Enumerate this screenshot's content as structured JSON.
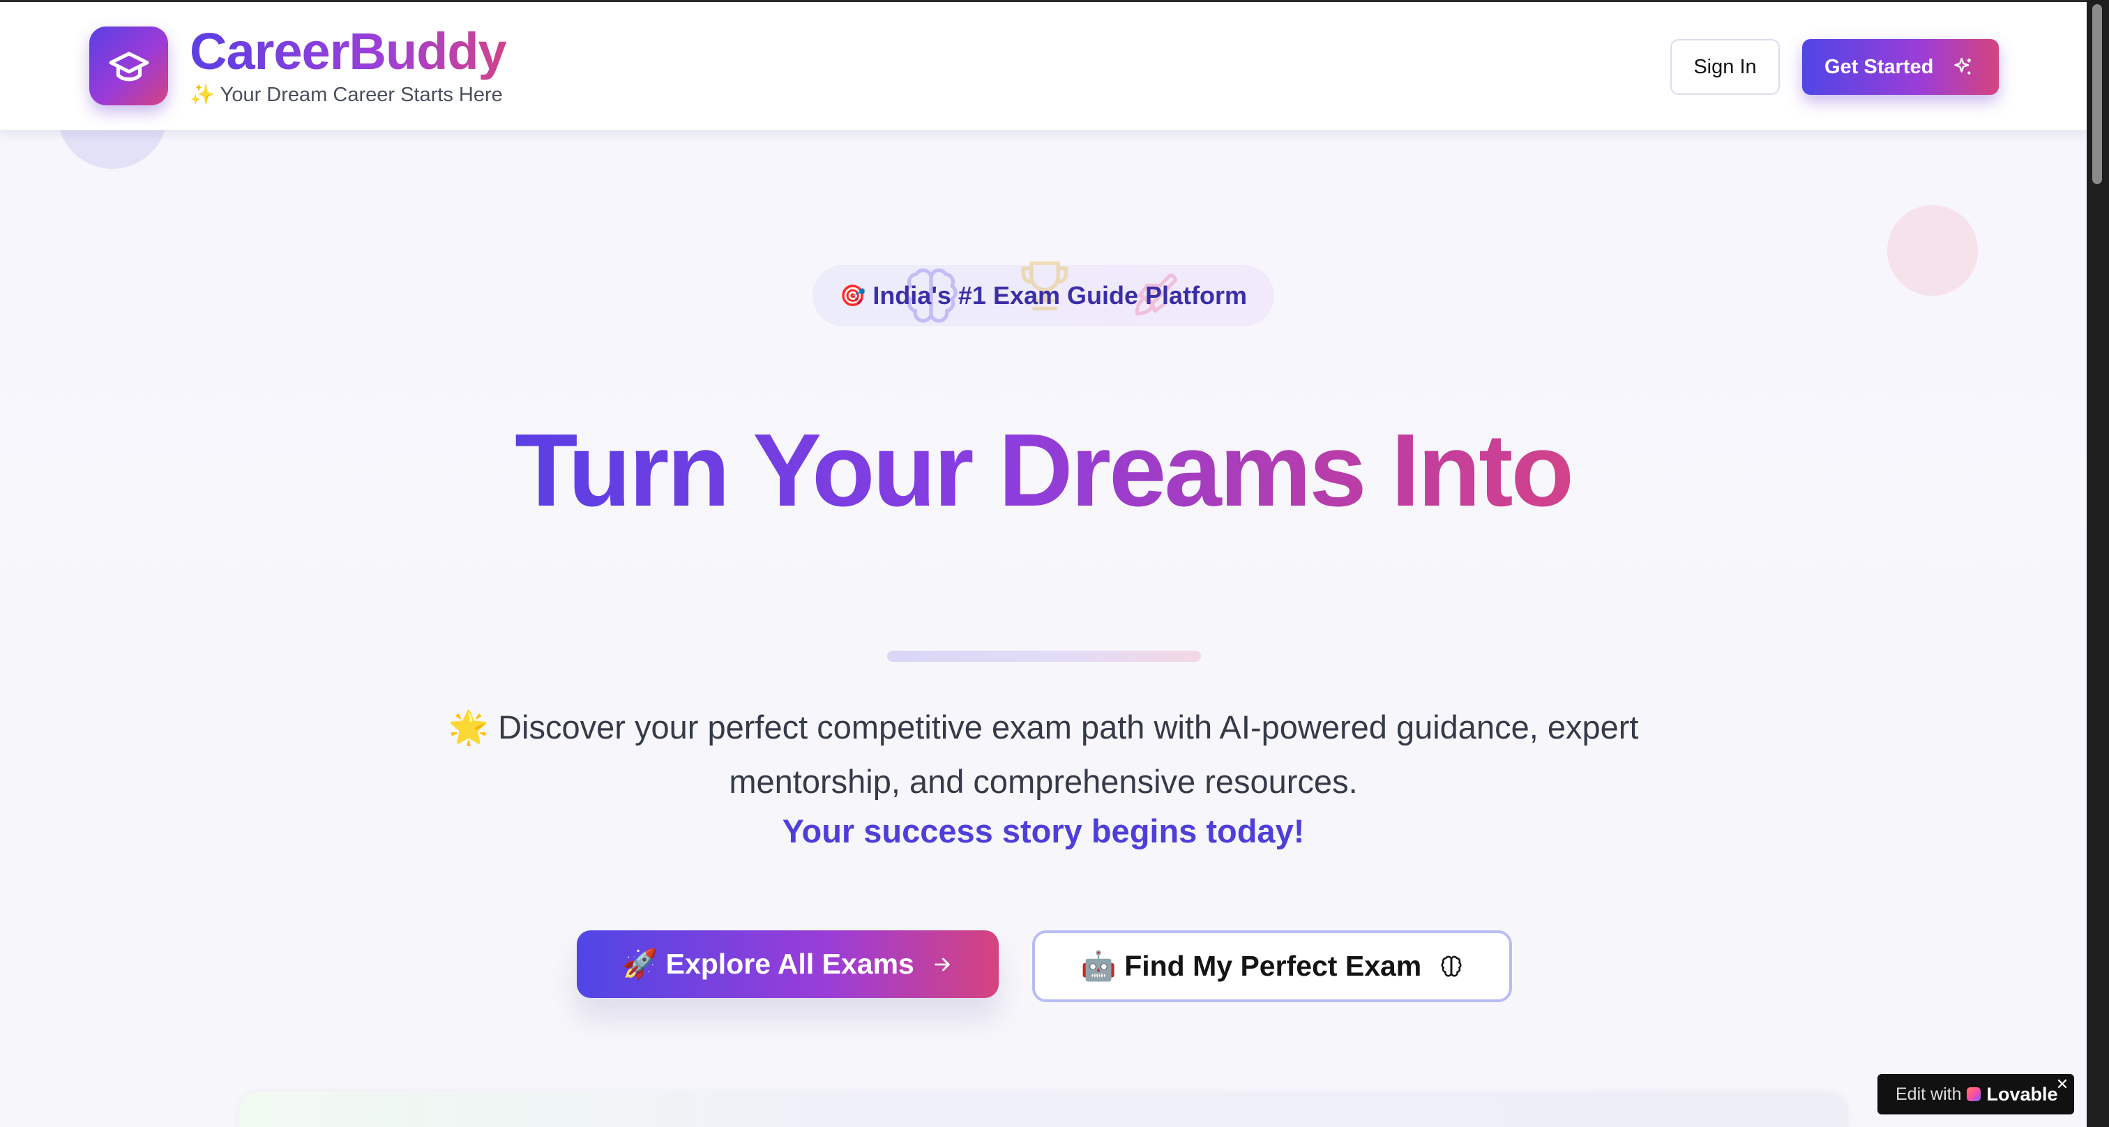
{
  "header": {
    "brand_name": "CareerBuddy",
    "tagline_icon": "✨",
    "tagline": "Your Dream Career Starts Here",
    "sign_in_label": "Sign In",
    "get_started_label": "Get Started",
    "logo_icon": "graduation-cap-icon",
    "get_started_icon": "sparkles-icon"
  },
  "hero": {
    "badge_emoji": "🎯",
    "badge_text": "India's #1 Exam Guide Platform",
    "title": "Turn Your Dreams Into",
    "description_emoji": "🌟",
    "description": "Discover your perfect competitive exam path with AI-powered guidance, expert mentorship, and comprehensive resources.",
    "highlight": "Your success story begins today!",
    "primary_cta": {
      "emoji": "🚀",
      "label": "Explore All Exams",
      "icon": "arrow-right-icon"
    },
    "secondary_cta": {
      "emoji": "🤖",
      "label": "Find My Perfect Exam",
      "icon": "brain-icon"
    }
  },
  "badge": {
    "edit_with": "Edit with",
    "brand": "Lovable",
    "close": "✕"
  },
  "colors": {
    "brand_indigo": "#4f46e5",
    "brand_purple": "#9b3dd7",
    "brand_pink": "#d6437f",
    "highlight_text": "#4f3fd9"
  }
}
